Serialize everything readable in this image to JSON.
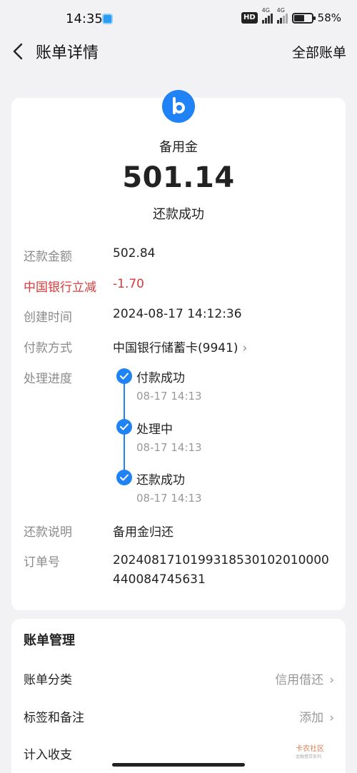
{
  "status_bar": {
    "time": "14:35",
    "hd_badge": "HD",
    "network_1": "4G",
    "network_2": "4G",
    "battery_percent": "58%",
    "battery_level": 0.58
  },
  "nav": {
    "title": "账单详情",
    "right_link": "全部账单",
    "back_icon": "chevron-left-icon"
  },
  "header": {
    "logo_icon": "b-logo-icon",
    "product_name": "备用金",
    "amount": "501.14",
    "status": "还款成功"
  },
  "details": [
    {
      "label": "还款金额",
      "value": "502.84",
      "highlight": false
    },
    {
      "label": "中国银行立减",
      "value": "-1.70",
      "highlight": true
    },
    {
      "label": "创建时间",
      "value": "2024-08-17 14:12:36",
      "highlight": false
    },
    {
      "label": "付款方式",
      "value": "中国银行储蓄卡(9941)",
      "highlight": false
    }
  ],
  "progress": {
    "label": "处理进度",
    "steps": [
      {
        "title": "付款成功",
        "time": "08-17 14:13"
      },
      {
        "title": "处理中",
        "time": "08-17 14:13"
      },
      {
        "title": "还款成功",
        "time": "08-17 14:13"
      }
    ]
  },
  "remark": {
    "label": "还款说明",
    "value": "备用金归还"
  },
  "order": {
    "label": "订单号",
    "value": "2024081710199318530102010000440084745631"
  },
  "manage": {
    "title": "账单管理",
    "rows": [
      {
        "label": "账单分类",
        "value": "信用借还"
      },
      {
        "label": "标签和备注",
        "value": "添加"
      },
      {
        "label": "计入收支",
        "value": ""
      }
    ]
  },
  "watermark": {
    "text": "卡农社区",
    "sub": "金融借贷系列"
  },
  "colors": {
    "accent": "#1f82f5",
    "danger": "#d93a3a",
    "background": "#f2f2f4"
  }
}
